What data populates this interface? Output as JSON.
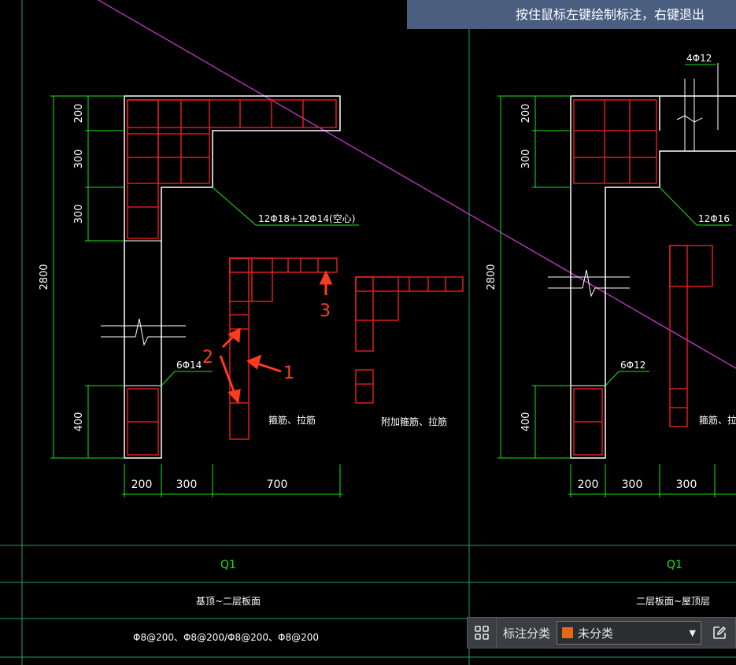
{
  "hint": {
    "text": "按住鼠标左键绘制标注，右键退出"
  },
  "annotation_bar": {
    "category_label": "标注分类",
    "selected": "未分类",
    "swatch_color": "#e8651a"
  },
  "colors": {
    "dim": "#19e619",
    "rebar": "#ff2020",
    "outline": "#ffffff",
    "grid": "#1fa06a",
    "diag": "#d43bd8",
    "annotation": "#ff3b1f"
  },
  "drawing": {
    "left": {
      "dims_vertical": [
        "200",
        "300",
        "300",
        "400"
      ],
      "total": "2800",
      "dims_horizontal": [
        "200",
        "300",
        "700"
      ],
      "callout_main": "12Φ18+12Φ14(空心)",
      "callout_web": "6Φ14",
      "stirrup_label": "箍筋、拉筋",
      "extra_label": "附加箍筋、拉筋",
      "markers": [
        "1",
        "2",
        "3"
      ]
    },
    "right": {
      "top_callout": "4Φ12",
      "dims_vertical": [
        "200",
        "300",
        "400"
      ],
      "total": "2800",
      "dims_horizontal": [
        "200",
        "300",
        "300"
      ],
      "callout_main": "12Φ16",
      "callout_web": "6Φ12",
      "stirrup_label": "箍筋、拉筋"
    },
    "table": {
      "wall_left": "Q1",
      "wall_right": "Q1",
      "range_left": "基顶~二层板面",
      "range_right": "二层板面~屋顶层",
      "rebar_left": "Φ8@200、Φ8@200/Φ8@200、Φ8@200"
    }
  }
}
